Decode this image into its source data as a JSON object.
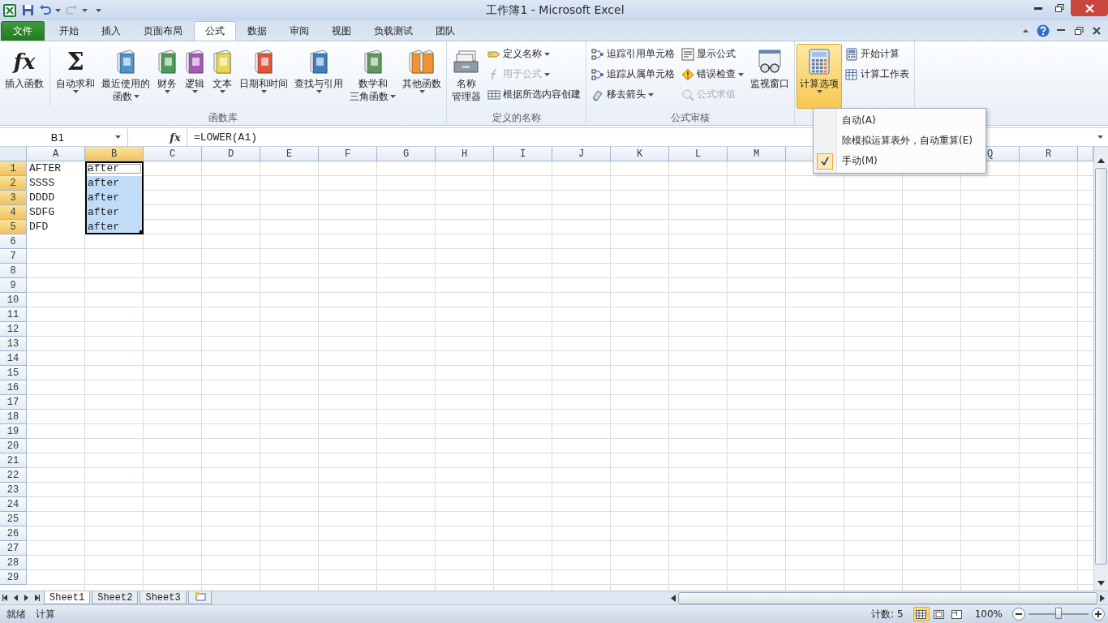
{
  "title_bar": {
    "title": "工作簿1 - Microsoft Excel"
  },
  "ribbon_tabs": [
    {
      "label": "文件",
      "kind": "file",
      "selected": false
    },
    {
      "label": "开始",
      "kind": "tab",
      "selected": false
    },
    {
      "label": "插入",
      "kind": "tab",
      "selected": false
    },
    {
      "label": "页面布局",
      "kind": "tab",
      "selected": false
    },
    {
      "label": "公式",
      "kind": "tab",
      "selected": true
    },
    {
      "label": "数据",
      "kind": "tab",
      "selected": false
    },
    {
      "label": "审阅",
      "kind": "tab",
      "selected": false
    },
    {
      "label": "视图",
      "kind": "tab",
      "selected": false
    },
    {
      "label": "负载测试",
      "kind": "tab",
      "selected": false
    },
    {
      "label": "团队",
      "kind": "tab",
      "selected": false
    }
  ],
  "ribbon_groups": [
    {
      "label": "函数库",
      "items": [
        {
          "kind": "fx",
          "glyph": "fx",
          "lines": [
            "插入函数"
          ],
          "expanded": false,
          "divider": true
        },
        {
          "kind": "sigma",
          "glyph": "Σ",
          "lines": [
            "自动求和"
          ],
          "dropdown": true,
          "expanded": false
        },
        {
          "kind": "book",
          "color": "#4f94c9",
          "lines": [
            "最近使用的",
            "函数"
          ],
          "dropdown": true,
          "expanded": false
        },
        {
          "kind": "book",
          "color": "#4e9a5a",
          "lines": [
            "财务"
          ],
          "dropdown": true,
          "expanded": false
        },
        {
          "kind": "book",
          "color": "#a55bb5",
          "lines": [
            "逻辑"
          ],
          "dropdown": true,
          "expanded": false
        },
        {
          "kind": "book",
          "color": "#e8d84a",
          "lines": [
            "文本"
          ],
          "dropdown": true,
          "expanded": false
        },
        {
          "kind": "book",
          "color": "#e0563a",
          "lines": [
            "日期和时间"
          ],
          "dropdown": true,
          "expanded": false
        },
        {
          "kind": "book",
          "color": "#3f7fc0",
          "lines": [
            "查找与引用"
          ],
          "dropdown": true,
          "expanded": false
        },
        {
          "kind": "book",
          "color": "#5e9a5e",
          "lines": [
            "数学和",
            "三角函数"
          ],
          "dropdown": true,
          "expanded": false
        },
        {
          "kind": "books",
          "color": "#f0922e",
          "lines": [
            "其他函数"
          ],
          "dropdown": true,
          "expanded": false
        }
      ]
    },
    {
      "label": "定义的名称",
      "items": [
        {
          "kind": "cards",
          "lines": [
            "名称",
            "管理器"
          ],
          "expanded": false
        },
        {
          "kind": "stack",
          "entries": [
            {
              "kind": "tag",
              "label": "定义名称",
              "dropdown": true,
              "disabled": false
            },
            {
              "kind": "function",
              "label": "用于公式",
              "dropdown": true,
              "disabled": true
            },
            {
              "kind": "table",
              "label": "根据所选内容创建",
              "disabled": false
            }
          ]
        }
      ]
    },
    {
      "label": "公式审核",
      "items": [
        {
          "kind": "stack",
          "entries": [
            {
              "kind": "trace",
              "label": "追踪引用单元格",
              "disabled": false
            },
            {
              "kind": "trace",
              "label": "追踪从属单元格",
              "disabled": false
            },
            {
              "kind": "eraser",
              "label": "移去箭头",
              "dropdown": true,
              "disabled": false
            }
          ]
        },
        {
          "kind": "stack",
          "entries": [
            {
              "kind": "formula",
              "label": "显示公式",
              "disabled": false
            },
            {
              "kind": "warning",
              "label": "错误检查",
              "dropdown": true,
              "disabled": false
            },
            {
              "kind": "magnifier",
              "label": "公式求值",
              "disabled": true
            }
          ]
        },
        {
          "kind": "glasses",
          "lines": [
            "监视窗口"
          ],
          "expanded": false
        }
      ]
    },
    {
      "items": [
        {
          "kind": "calculator",
          "lines": [
            "计算选项"
          ],
          "dropdown": true,
          "expanded": true
        },
        {
          "kind": "stack",
          "entries": [
            {
              "kind": "calculator",
              "label": "开始计算",
              "disabled": false
            },
            {
              "kind": "sheet",
              "label": "计算工作表",
              "disabled": false
            }
          ]
        }
      ]
    }
  ],
  "calc_menu": {
    "items": [
      {
        "label": "自动(A)",
        "checked": false
      },
      {
        "label": "除模拟运算表外，自动重算(E)",
        "checked": false
      },
      {
        "label": "手动(M)",
        "checked": true
      }
    ]
  },
  "formula_bar": {
    "name_box": "B1",
    "fx": "fx",
    "formula": "=LOWER(A1)"
  },
  "columns": [
    {
      "label": "A",
      "selected": false
    },
    {
      "label": "B",
      "selected": true
    },
    {
      "label": "C",
      "selected": false
    },
    {
      "label": "D",
      "selected": false
    },
    {
      "label": "E",
      "selected": false
    },
    {
      "label": "F",
      "selected": false
    },
    {
      "label": "G",
      "selected": false
    },
    {
      "label": "H",
      "selected": false
    },
    {
      "label": "I",
      "selected": false
    },
    {
      "label": "J",
      "selected": false
    },
    {
      "label": "K",
      "selected": false
    },
    {
      "label": "L",
      "selected": false
    },
    {
      "label": "M",
      "selected": false
    },
    {
      "selected": false
    },
    {},
    {},
    {
      "label": "Q",
      "selected": false
    },
    {
      "label": "R",
      "selected": false
    }
  ],
  "rows": [
    {
      "label": "1",
      "selected": true,
      "cells": [
        {
          "text": "AFTER",
          "selected": false,
          "active": false
        },
        {
          "text": "after",
          "selected": true,
          "active": true
        }
      ]
    },
    {
      "label": "2",
      "selected": true,
      "cells": [
        {
          "text": "SSSS",
          "selected": false,
          "active": false
        },
        {
          "text": "after",
          "selected": true,
          "active": false
        }
      ]
    },
    {
      "label": "3",
      "selected": true,
      "cells": [
        {
          "text": "DDDD",
          "selected": false,
          "active": false
        },
        {
          "text": "after",
          "selected": true,
          "active": false
        }
      ]
    },
    {
      "label": "4",
      "selected": true,
      "cells": [
        {
          "text": "SDFG",
          "selected": false,
          "active": false
        },
        {
          "text": "after",
          "selected": true,
          "active": false
        }
      ]
    },
    {
      "label": "5",
      "selected": true,
      "cells": [
        {
          "text": "DFD",
          "selected": false,
          "active": false
        },
        {
          "text": "after",
          "selected": true,
          "active": false
        }
      ]
    },
    {
      "label": "6",
      "selected": false
    },
    {
      "label": "7",
      "selected": false
    },
    {
      "label": "8",
      "selected": false
    },
    {
      "label": "9",
      "selected": false
    },
    {
      "label": "10",
      "selected": false
    },
    {
      "label": "11",
      "selected": false
    },
    {
      "label": "12",
      "selected": false
    },
    {
      "label": "13",
      "selected": false
    },
    {
      "label": "14",
      "selected": false
    },
    {
      "label": "15",
      "selected": false
    },
    {
      "label": "16",
      "selected": false
    },
    {
      "label": "17",
      "selected": false
    },
    {
      "label": "18",
      "selected": false
    },
    {
      "label": "19",
      "selected": false
    },
    {
      "label": "20",
      "selected": false
    },
    {
      "label": "21",
      "selected": false
    },
    {
      "label": "22",
      "selected": false
    },
    {
      "label": "23",
      "selected": false
    },
    {
      "label": "24",
      "selected": false
    },
    {
      "label": "25",
      "selected": false
    },
    {
      "label": "26",
      "selected": false
    },
    {
      "label": "27",
      "selected": false
    },
    {
      "label": "28",
      "selected": false
    },
    {
      "label": "29",
      "selected": false
    }
  ],
  "sheet_tabs": [
    {
      "label": "Sheet1",
      "selected": true
    },
    {
      "label": "Sheet2",
      "selected": false
    },
    {
      "label": "Sheet3",
      "selected": false
    }
  ],
  "status_bar": {
    "mode": "就绪",
    "calc": "计算",
    "count": "计数: 5",
    "views": [
      {
        "kind": "normal",
        "selected": true
      },
      {
        "kind": "layout",
        "selected": false
      },
      {
        "kind": "pagebreak",
        "selected": false
      }
    ],
    "zoom": "100%",
    "zoom_slider": {
      "level": 0.5
    }
  }
}
